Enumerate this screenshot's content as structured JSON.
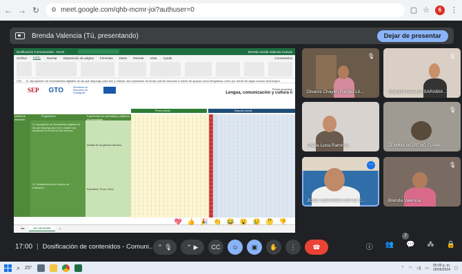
{
  "browser": {
    "url": "meet.google.com/qhb-mcmr-joi?authuser=0",
    "profile_initial": "6"
  },
  "presenting": {
    "label": "Brenda Valencia (Tú, presentando)",
    "stop_button": "Dejar de presentar"
  },
  "excel": {
    "filename": "Dosificación Comunicación - Excel",
    "search": "Buscar",
    "user": "Brenda Amalia Valencia Cuevas",
    "menu": [
      "Archivo",
      "Inicio",
      "Insertar",
      "Disposición de página",
      "Fórmulas",
      "Datos",
      "Revisar",
      "Vista",
      "Ayuda"
    ],
    "active_menu": "Inicio",
    "comments": "Comentarios",
    "cell_ref": "C20",
    "formula": "11. Apropiación de herramientas digitales de las que dispongo para leer y realizar una exposición de forma oral del resumen a través de apoyos como infografías o bien por medio de algún recurso tecnológico",
    "logo_sep": "SEP",
    "logo_gto": "GTO",
    "logo_gto_sub": "Secretaría de Educación de Guanajuato",
    "sheet_title_small": "Primer semestre",
    "sheet_title": "Lengua, comunicación y cultura ii",
    "col_unidad": "Unidad de formación",
    "col_progresiones": "Progresiones",
    "col_experiencias": "Experiencias de aprendizaje y objetivos de aprendizaje...",
    "parcial_1": "Primer parcial",
    "parcial_2": "Segundo parcial",
    "tab": "1er semestre"
  },
  "participants": [
    {
      "name": "Divanni Chayén Rangel Ló...",
      "muted": true
    },
    {
      "name": "NORMA ISAURA SARABIA ...",
      "muted": true
    },
    {
      "name": "Thalia Luna Ramírez",
      "muted": false
    },
    {
      "name": "JEMIMA MORENO GAMA",
      "muted": true
    },
    {
      "name": "JOSE GERARDO ORTIZ C...",
      "muted": false,
      "speaking": true
    },
    {
      "name": "Brenda Valencia",
      "muted": true
    }
  ],
  "reactions": [
    "💖",
    "👍",
    "🎉",
    "👏",
    "😂",
    "😮",
    "😢",
    "🤔",
    "👎"
  ],
  "controls": {
    "time": "17:00",
    "meeting_title": "Dosificación de contenidos - Comuni...",
    "participant_badge": "7"
  },
  "taskbar": {
    "weather": "25°",
    "time": "05:00 p. m.",
    "date": "26/06/2024"
  },
  "colors": {
    "meet_bg": "#202124",
    "accent_blue": "#8ab4f8",
    "end_call_red": "#ea4335",
    "excel_green": "#1e6e42"
  }
}
